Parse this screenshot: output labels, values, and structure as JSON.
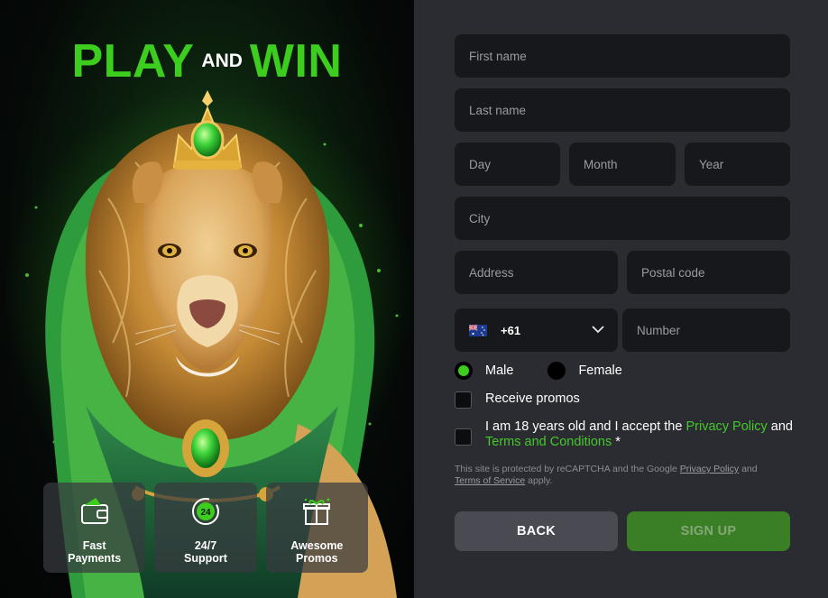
{
  "promo": {
    "headline_left": "PLAY",
    "headline_mid": "AND",
    "headline_right": "WIN",
    "features": [
      {
        "icon": "wallet-icon",
        "label": "Fast\nPayments"
      },
      {
        "icon": "support-24-icon",
        "label": "24/7\nSupport"
      },
      {
        "icon": "gift-icon",
        "label": "Awesome\nPromos"
      }
    ],
    "colors": {
      "accent": "#3ccd1e",
      "background": "#050907"
    }
  },
  "form": {
    "first_name_placeholder": "First name",
    "last_name_placeholder": "Last name",
    "day_placeholder": "Day",
    "month_placeholder": "Month",
    "year_placeholder": "Year",
    "city_placeholder": "City",
    "address_placeholder": "Address",
    "postal_placeholder": "Postal code",
    "phone_code": "+61",
    "phone_flag": "australia-flag-icon",
    "number_placeholder": "Number",
    "gender": {
      "male": "Male",
      "female": "Female",
      "selected": "Male"
    },
    "receive_promos": "Receive promos",
    "age_text": "I am 18 years old and I accept the",
    "privacy_link": "Privacy Policy",
    "and_text": "and",
    "terms_link": "Terms and Conditions",
    "required_mark": "*",
    "recaptcha_prefix": "This site is protected by reCAPTCHA and the Google",
    "recaptcha_privacy": "Privacy Policy",
    "recaptcha_and": "and",
    "recaptcha_terms": "Terms of Service",
    "recaptcha_suffix": "apply.",
    "back_label": "BACK",
    "signup_label": "SIGN UP",
    "colors": {
      "field_bg": "#17181c",
      "panel_bg": "#2b2c31",
      "link": "#45c82a",
      "signup_bg": "#3a7e25",
      "back_bg": "#4a4b52"
    }
  }
}
